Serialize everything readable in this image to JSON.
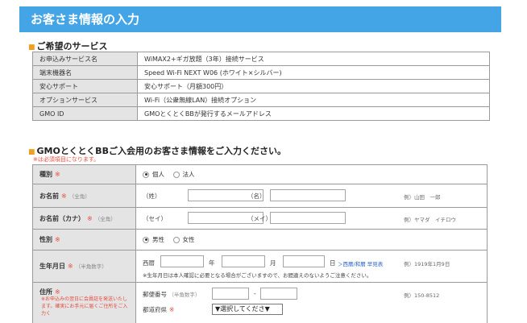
{
  "header": {
    "title": "お客さま情報の入力"
  },
  "service_section": {
    "title": "ご希望のサービス",
    "rows": [
      {
        "label": "お申込みサービス名",
        "value": "WiMAX2+ギガ放題（3年）接続サービス"
      },
      {
        "label": "端末機器名",
        "value": "Speed Wi-Fi NEXT W06 (ホワイト×シルバー)"
      },
      {
        "label": "安心サポート",
        "value": "安心サポート（月額300円）"
      },
      {
        "label": "オプションサービス",
        "value": "Wi-Fi（公衆無線LAN）接続オプション"
      },
      {
        "label": "GMO ID",
        "value": "GMOとくとくBBが発行するメールアドレス"
      }
    ]
  },
  "customer_section": {
    "title": "GMOとくとくBBご入会用のお客さま情報をご入力ください。",
    "required_note": "※は必須項目になります。",
    "required_mark": "※",
    "type": {
      "label": "種別",
      "options": [
        "個人",
        "法人"
      ],
      "selected": "個人"
    },
    "name": {
      "label": "お名前",
      "sub": "（全角）",
      "sei": "（姓）",
      "mei": "（名）",
      "example": "例）山田　一郎"
    },
    "name_kana": {
      "label": "お名前（カナ）",
      "sub": "（全角）",
      "sei": "（セイ）",
      "mei": "（メイ）",
      "example": "例）ヤマダ　イチロウ"
    },
    "gender": {
      "label": "性別",
      "options": [
        "男性",
        "女性"
      ],
      "selected": "男性"
    },
    "birthday": {
      "label": "生年月日",
      "sub": "（半角数字）",
      "era": "西暦",
      "year": "年",
      "month": "月",
      "day": "日",
      "link": "＞西暦/和暦 早見表",
      "example": "例）1919年1月9日",
      "note": "※生年月日は本人確認に必要となる場合がございますので、お間違えのないようご注意ください。"
    },
    "address": {
      "label": "住所",
      "note": "※お申込みの翌日に会員証を発送いたします。確実にお手元に届くご住所をご入力く",
      "postal_label": "郵便番号",
      "postal_sub": "（半角数字）",
      "postal_sep": "-",
      "postal_example": "例）150-8512",
      "pref_label": "都道府県",
      "pref_select": "▼選択してくださ▼"
    }
  }
}
